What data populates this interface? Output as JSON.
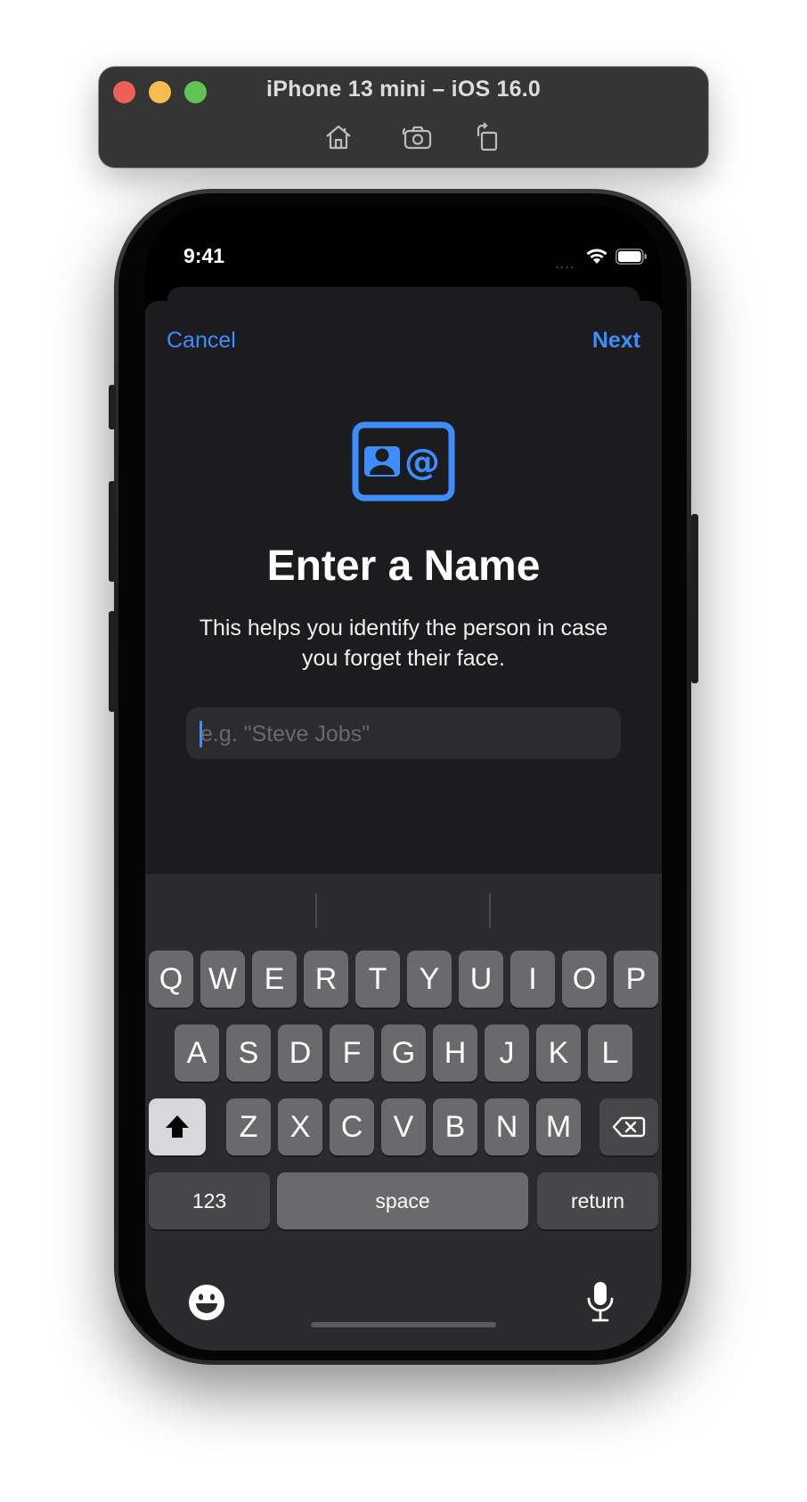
{
  "simulator": {
    "title": "iPhone 13 mini – iOS 16.0",
    "toolbar": [
      "home-icon",
      "screenshot-icon",
      "rotate-icon"
    ]
  },
  "status_bar": {
    "time": "9:41",
    "signal": "····"
  },
  "sheet": {
    "cancel_label": "Cancel",
    "next_label": "Next",
    "title": "Enter a Name",
    "subtitle": "This helps you identify the person in case you forget their face.",
    "name_placeholder": "e.g. \"Steve Jobs\"",
    "name_value": ""
  },
  "keyboard": {
    "row1": [
      "Q",
      "W",
      "E",
      "R",
      "T",
      "Y",
      "U",
      "I",
      "O",
      "P"
    ],
    "row2": [
      "A",
      "S",
      "D",
      "F",
      "G",
      "H",
      "J",
      "K",
      "L"
    ],
    "row3": [
      "Z",
      "X",
      "C",
      "V",
      "B",
      "N",
      "M"
    ],
    "numbers_label": "123",
    "space_label": "space",
    "return_label": "return"
  },
  "colors": {
    "accent": "#3c8dff",
    "sheet_bg": "#1c1c1e",
    "keyboard_bg": "#2b2b2d"
  }
}
